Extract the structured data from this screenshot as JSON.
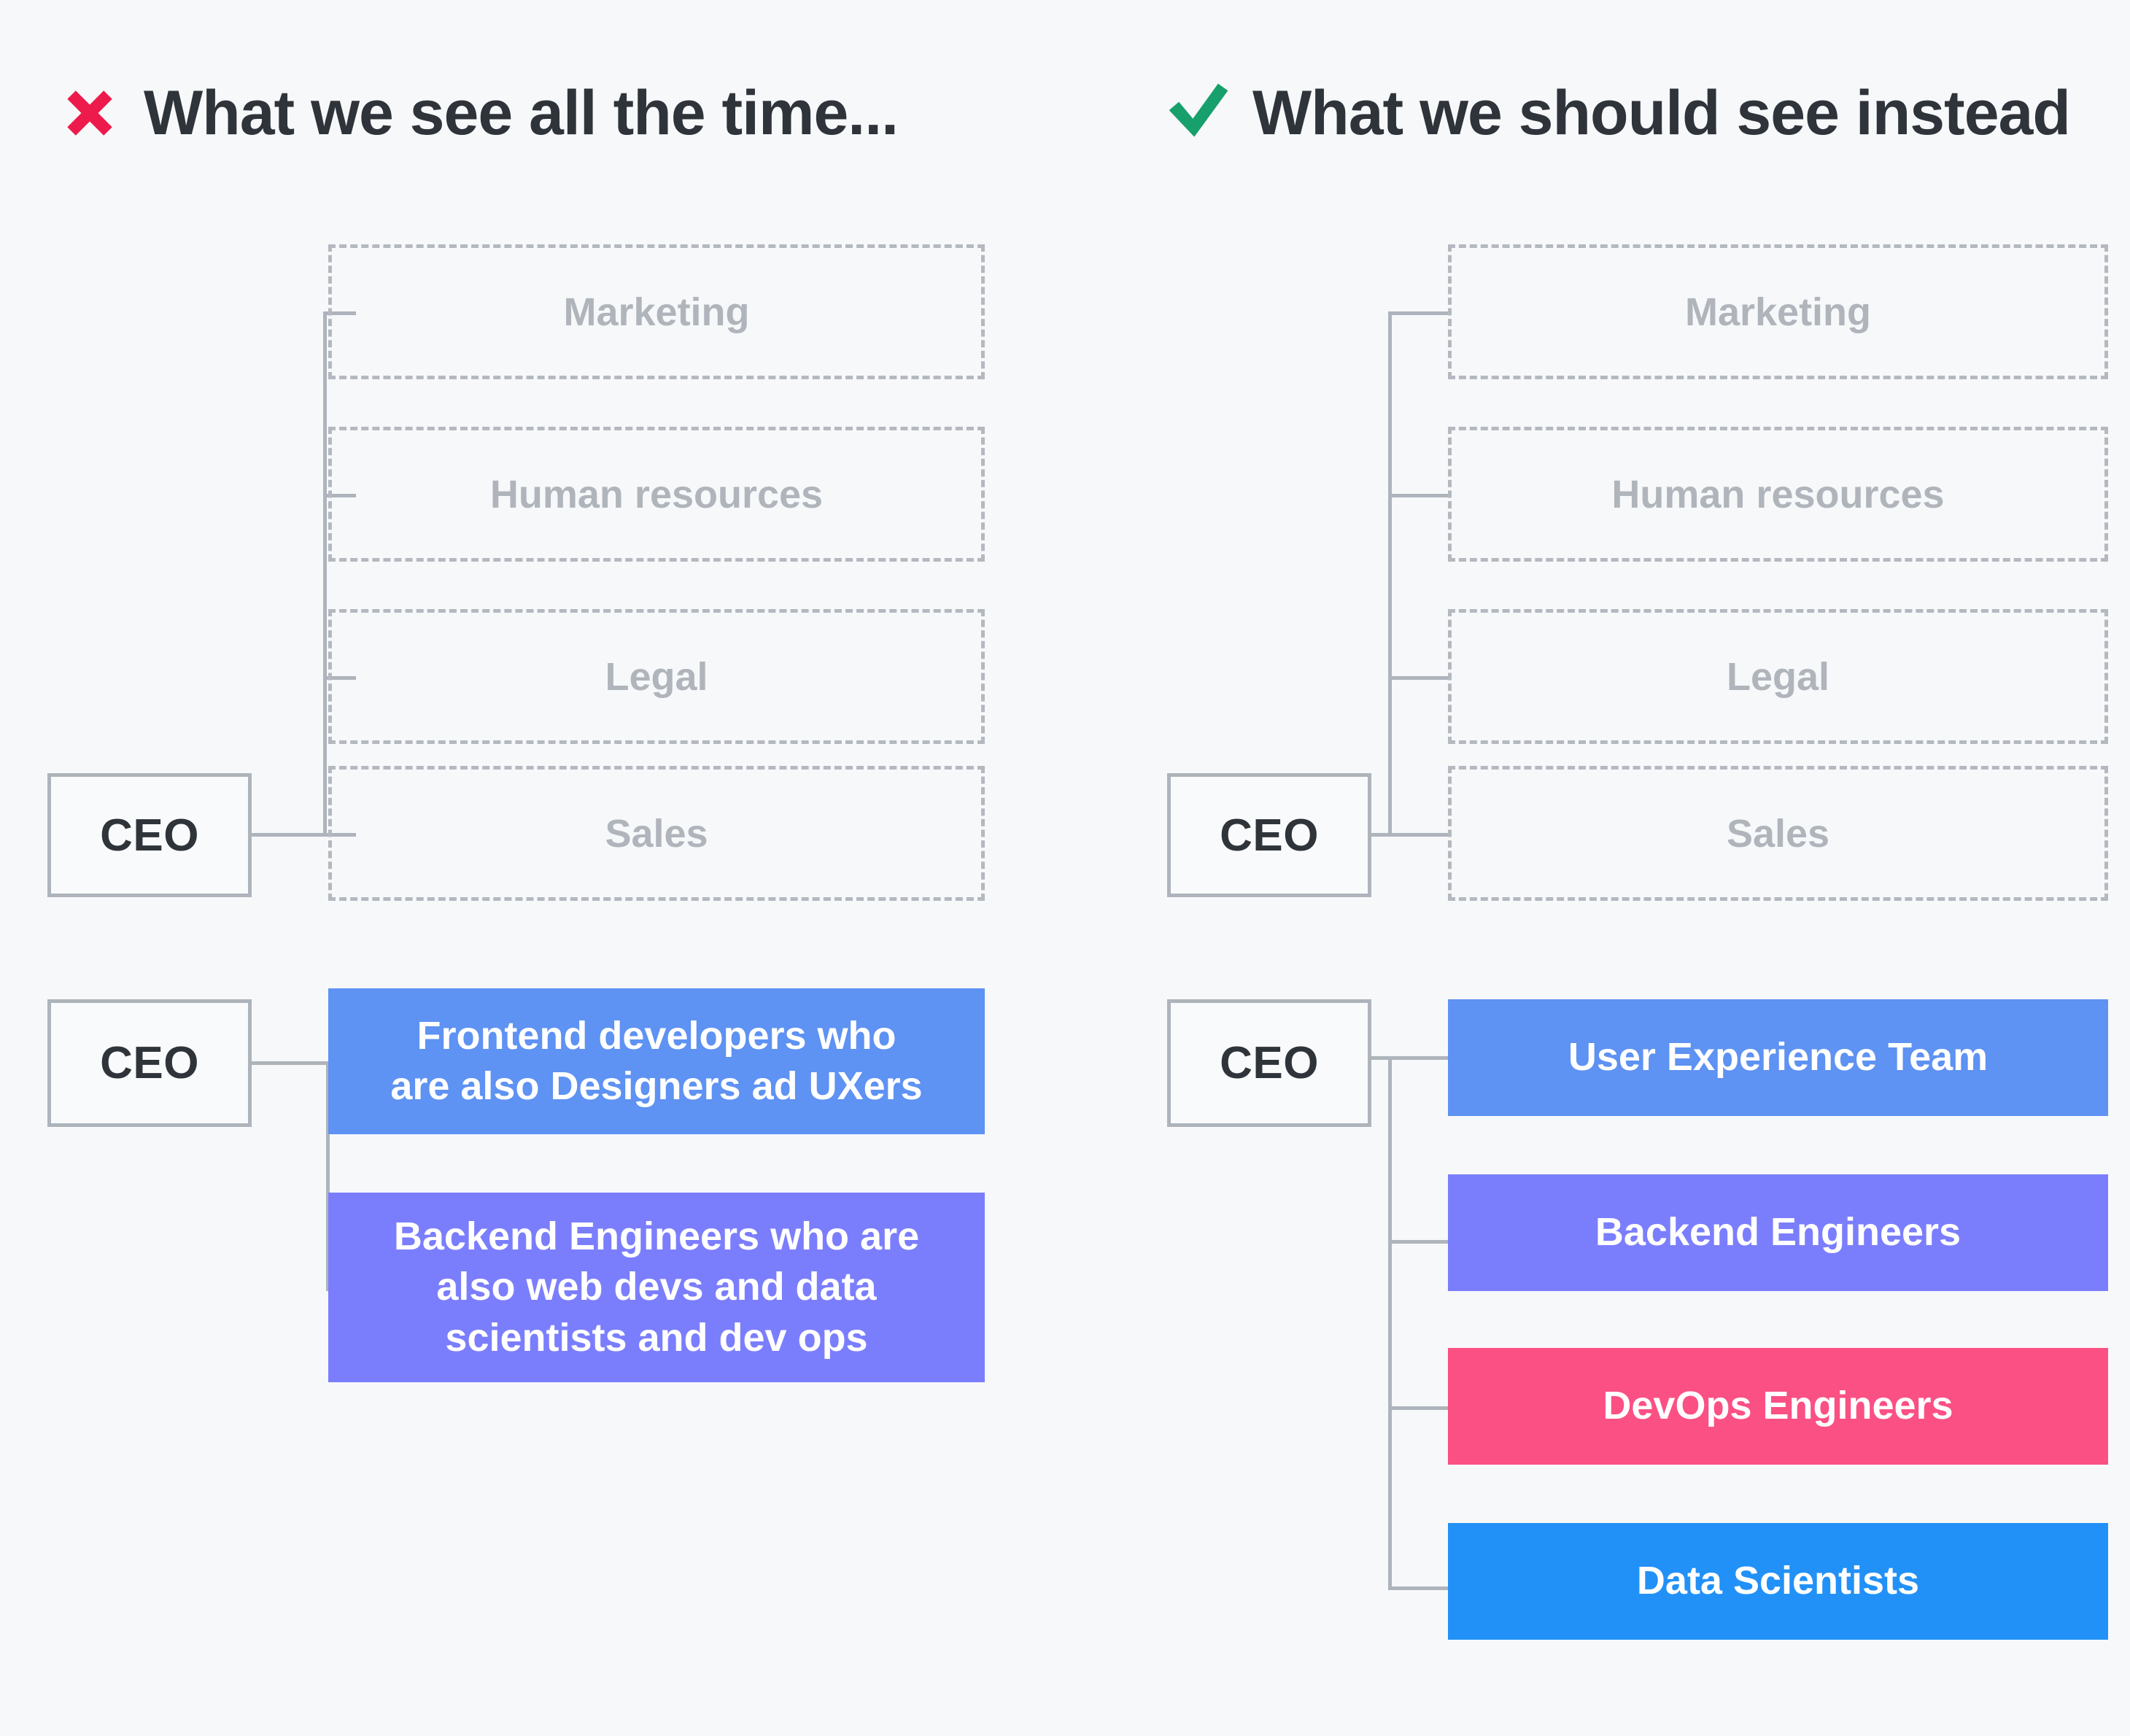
{
  "page": {
    "background_color": "#f7f8fa",
    "line_color": "#aeb4bb",
    "muted_text_color": "#b0b5bc",
    "dark_text_color": "#2f343a"
  },
  "headers": {
    "left": {
      "icon": "cross-mark-icon",
      "icon_color": "#ed1b4c",
      "title": "What we see all the time..."
    },
    "right": {
      "icon": "check-mark-icon",
      "icon_color": "#17a06c",
      "title": "What we should see instead"
    }
  },
  "left_panel": {
    "top_tree": {
      "root_label": "CEO",
      "children": [
        {
          "label": "Marketing"
        },
        {
          "label": "Human resources"
        },
        {
          "label": "Legal"
        },
        {
          "label": "Sales"
        }
      ]
    },
    "bottom_tree": {
      "root_label": "CEO",
      "children": [
        {
          "label": "Frontend developers who\nare also Designers ad UXers",
          "color": "#5e92f3"
        },
        {
          "label": "Backend Engineers who are\nalso web devs and data\nscientists and dev ops",
          "color": "#7b7efc"
        }
      ]
    }
  },
  "right_panel": {
    "top_tree": {
      "root_label": "CEO",
      "children": [
        {
          "label": "Marketing"
        },
        {
          "label": "Human resources"
        },
        {
          "label": "Legal"
        },
        {
          "label": "Sales"
        }
      ]
    },
    "bottom_tree": {
      "root_label": "CEO",
      "children": [
        {
          "label": "User Experience Team",
          "color": "#5e92f3"
        },
        {
          "label": "Backend Engineers",
          "color": "#7b7efc"
        },
        {
          "label": "DevOps Engineers",
          "color": "#fb5084"
        },
        {
          "label": "Data Scientists",
          "color": "#2291f7"
        }
      ]
    }
  }
}
